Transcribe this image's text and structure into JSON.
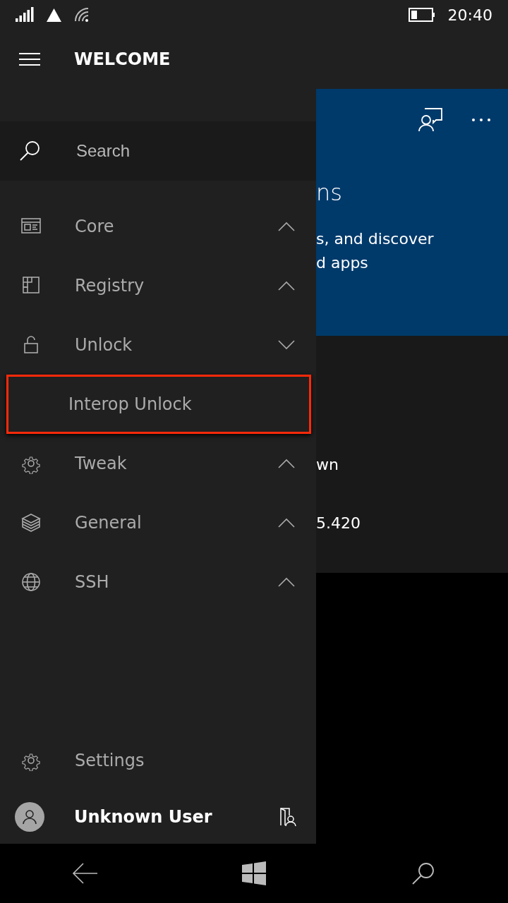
{
  "status_bar": {
    "time": "20:40"
  },
  "header": {
    "title": "WELCOME"
  },
  "search": {
    "placeholder": "Search"
  },
  "nav_items": [
    {
      "label": "Core",
      "expanded": false
    },
    {
      "label": "Registry",
      "expanded": false
    },
    {
      "label": "Unlock",
      "expanded": true,
      "children": [
        {
          "label": "Interop Unlock",
          "highlighted": true
        }
      ]
    },
    {
      "label": "Tweak",
      "expanded": false
    },
    {
      "label": "General",
      "expanded": false
    },
    {
      "label": "SSH",
      "expanded": false
    }
  ],
  "footer": {
    "settings": "Settings",
    "user": "Unknown User"
  },
  "background_page": {
    "card_title": "ns",
    "card_lines": [
      "s, and discover",
      "d apps"
    ],
    "lines": [
      "wn",
      "5.420"
    ]
  }
}
